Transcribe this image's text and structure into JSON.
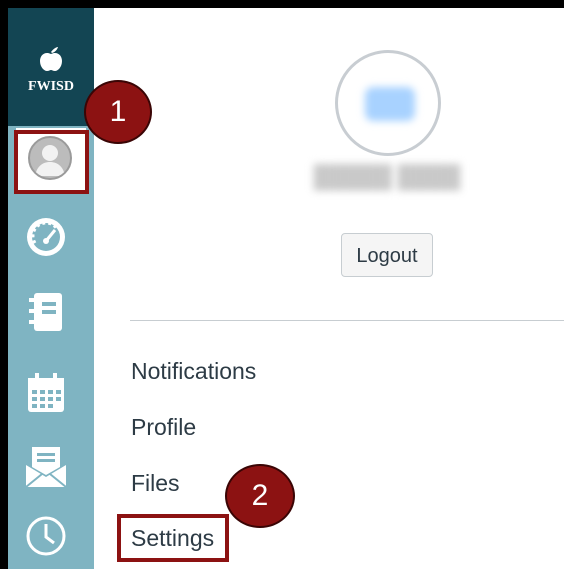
{
  "sidebar": {
    "logo_text": "FWISD",
    "nav_icons": [
      "account-avatar-icon",
      "dashboard-icon",
      "courses-icon",
      "calendar-icon",
      "inbox-icon",
      "history-icon"
    ]
  },
  "annotations": {
    "step1": "1",
    "step2": "2",
    "highlight_color": "#8c1212"
  },
  "account_tray": {
    "logout_label": "Logout",
    "links": [
      {
        "label": "Notifications"
      },
      {
        "label": "Profile"
      },
      {
        "label": "Files"
      },
      {
        "label": "Settings"
      }
    ]
  },
  "colors": {
    "sidebar_bg": "#7fb4c2",
    "logo_bg": "#134553",
    "text": "#2d3b45"
  }
}
